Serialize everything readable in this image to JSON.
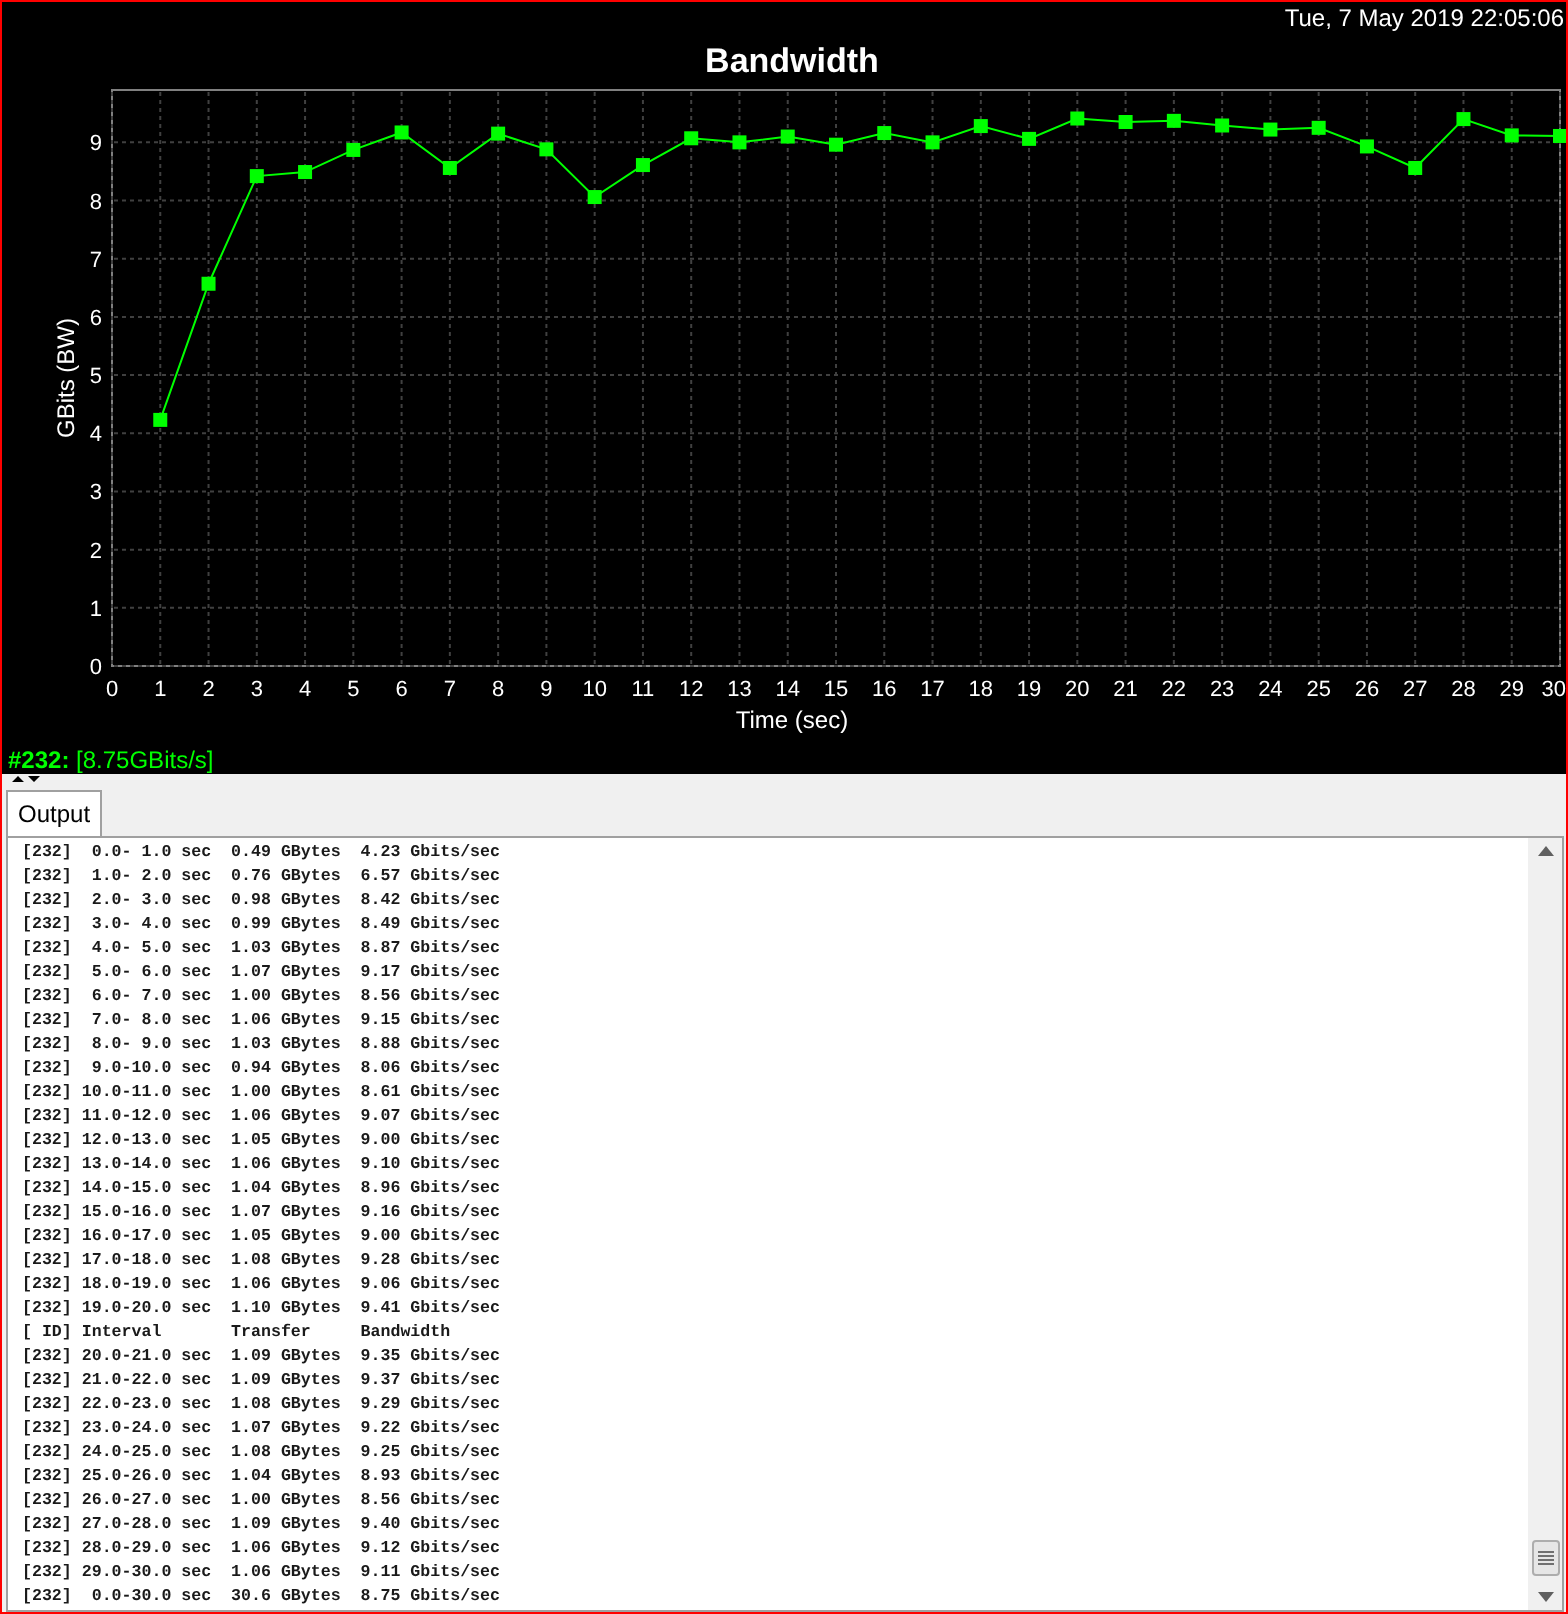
{
  "datetime": "Tue, 7 May 2019 22:05:06",
  "chart_data": {
    "type": "line",
    "title": "Bandwidth",
    "xlabel": "Time (sec)",
    "ylabel": "GBits (BW)",
    "x": [
      1,
      2,
      3,
      4,
      5,
      6,
      7,
      8,
      9,
      10,
      11,
      12,
      13,
      14,
      15,
      16,
      17,
      18,
      19,
      20,
      21,
      22,
      23,
      24,
      25,
      26,
      27,
      28,
      29,
      30
    ],
    "series": [
      {
        "color": "#00ff00",
        "marker": "square",
        "values": [
          4.23,
          6.57,
          8.42,
          8.49,
          8.87,
          9.17,
          8.56,
          9.15,
          8.88,
          8.06,
          8.61,
          9.07,
          9.0,
          9.1,
          8.96,
          9.16,
          9.0,
          9.28,
          9.06,
          9.41,
          9.35,
          9.37,
          9.29,
          9.22,
          9.25,
          8.93,
          8.56,
          9.4,
          9.12,
          9.11
        ]
      }
    ],
    "xlim": [
      0,
      30
    ],
    "ylim": [
      0,
      9.9
    ],
    "grid": true,
    "xticks": [
      0,
      1,
      2,
      3,
      4,
      5,
      6,
      7,
      8,
      9,
      10,
      11,
      12,
      13,
      14,
      15,
      16,
      17,
      18,
      19,
      20,
      21,
      22,
      23,
      24,
      25,
      26,
      27,
      28,
      29,
      30
    ],
    "yticks": [
      0,
      1,
      2,
      3,
      4,
      5,
      6,
      7,
      8,
      9
    ]
  },
  "status": "**#232:** [8.75GBits/s]",
  "tabs": [
    {
      "label": "Output",
      "selected": true
    }
  ],
  "output_lines": [
    "[232]  0.0- 1.0 sec  0.49 GBytes  4.23 Gbits/sec",
    "[232]  1.0- 2.0 sec  0.76 GBytes  6.57 Gbits/sec",
    "[232]  2.0- 3.0 sec  0.98 GBytes  8.42 Gbits/sec",
    "[232]  3.0- 4.0 sec  0.99 GBytes  8.49 Gbits/sec",
    "[232]  4.0- 5.0 sec  1.03 GBytes  8.87 Gbits/sec",
    "[232]  5.0- 6.0 sec  1.07 GBytes  9.17 Gbits/sec",
    "[232]  6.0- 7.0 sec  1.00 GBytes  8.56 Gbits/sec",
    "[232]  7.0- 8.0 sec  1.06 GBytes  9.15 Gbits/sec",
    "[232]  8.0- 9.0 sec  1.03 GBytes  8.88 Gbits/sec",
    "[232]  9.0-10.0 sec  0.94 GBytes  8.06 Gbits/sec",
    "[232] 10.0-11.0 sec  1.00 GBytes  8.61 Gbits/sec",
    "[232] 11.0-12.0 sec  1.06 GBytes  9.07 Gbits/sec",
    "[232] 12.0-13.0 sec  1.05 GBytes  9.00 Gbits/sec",
    "[232] 13.0-14.0 sec  1.06 GBytes  9.10 Gbits/sec",
    "[232] 14.0-15.0 sec  1.04 GBytes  8.96 Gbits/sec",
    "[232] 15.0-16.0 sec  1.07 GBytes  9.16 Gbits/sec",
    "[232] 16.0-17.0 sec  1.05 GBytes  9.00 Gbits/sec",
    "[232] 17.0-18.0 sec  1.08 GBytes  9.28 Gbits/sec",
    "[232] 18.0-19.0 sec  1.06 GBytes  9.06 Gbits/sec",
    "[232] 19.0-20.0 sec  1.10 GBytes  9.41 Gbits/sec",
    "[ ID] Interval       Transfer     Bandwidth",
    "[232] 20.0-21.0 sec  1.09 GBytes  9.35 Gbits/sec",
    "[232] 21.0-22.0 sec  1.09 GBytes  9.37 Gbits/sec",
    "[232] 22.0-23.0 sec  1.08 GBytes  9.29 Gbits/sec",
    "[232] 23.0-24.0 sec  1.07 GBytes  9.22 Gbits/sec",
    "[232] 24.0-25.0 sec  1.08 GBytes  9.25 Gbits/sec",
    "[232] 25.0-26.0 sec  1.04 GBytes  8.93 Gbits/sec",
    "[232] 26.0-27.0 sec  1.00 GBytes  8.56 Gbits/sec",
    "[232] 27.0-28.0 sec  1.09 GBytes  9.40 Gbits/sec",
    "[232] 28.0-29.0 sec  1.06 GBytes  9.12 Gbits/sec",
    "[232] 29.0-30.0 sec  1.06 GBytes  9.11 Gbits/sec",
    "[232]  0.0-30.0 sec  30.6 GBytes  8.75 Gbits/sec"
  ]
}
